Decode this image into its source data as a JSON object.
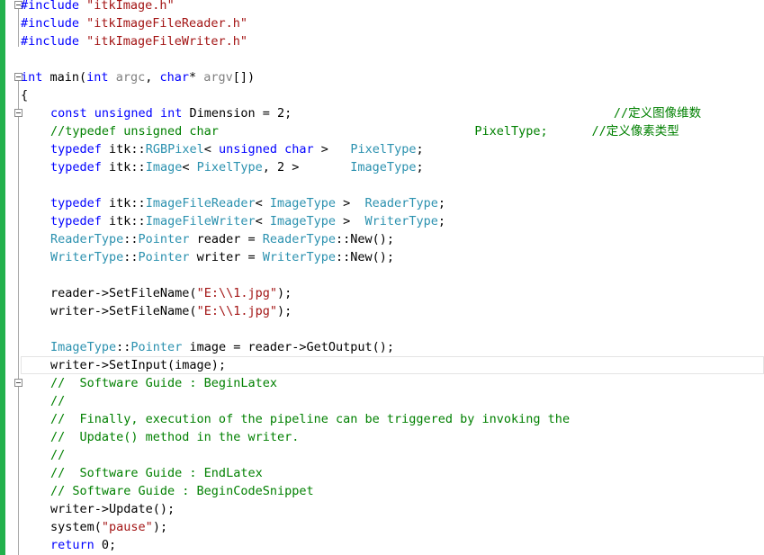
{
  "editor": {
    "lines": [
      {
        "indent": 0,
        "tokens": [
          {
            "t": "#include",
            "c": "pp"
          },
          {
            "t": " \"itkImage.h\"",
            "c": "str"
          }
        ]
      },
      {
        "indent": 0,
        "tokens": [
          {
            "t": "#include",
            "c": "pp"
          },
          {
            "t": " \"itkImageFileReader.h\"",
            "c": "str"
          }
        ]
      },
      {
        "indent": 0,
        "tokens": [
          {
            "t": "#include",
            "c": "pp"
          },
          {
            "t": " \"itkImageFileWriter.h\"",
            "c": "str"
          }
        ]
      },
      {
        "indent": 0,
        "tokens": []
      },
      {
        "indent": 0,
        "tokens": [
          {
            "t": "int",
            "c": "kw"
          },
          {
            "t": " main(",
            "c": "plain"
          },
          {
            "t": "int",
            "c": "kw"
          },
          {
            "t": " ",
            "c": "plain"
          },
          {
            "t": "argc",
            "c": "param"
          },
          {
            "t": ", ",
            "c": "plain"
          },
          {
            "t": "char",
            "c": "kw"
          },
          {
            "t": "* ",
            "c": "plain"
          },
          {
            "t": "argv",
            "c": "param"
          },
          {
            "t": "[])",
            "c": "plain"
          }
        ]
      },
      {
        "indent": 0,
        "tokens": [
          {
            "t": "{",
            "c": "plain"
          }
        ]
      },
      {
        "indent": 1,
        "tokens": [
          {
            "t": "const",
            "c": "kw"
          },
          {
            "t": " ",
            "c": "plain"
          },
          {
            "t": "unsigned",
            "c": "kw"
          },
          {
            "t": " ",
            "c": "plain"
          },
          {
            "t": "int",
            "c": "kw"
          },
          {
            "t": " Dimension = 2;                                            ",
            "c": "plain"
          },
          {
            "t": "//定义图像维数",
            "c": "cm"
          }
        ]
      },
      {
        "indent": 1,
        "tokens": [
          {
            "t": "//typedef unsigned char                                   ",
            "c": "cm"
          },
          {
            "t": "PixelType;      //定义像素类型",
            "c": "cm"
          }
        ]
      },
      {
        "indent": 1,
        "tokens": [
          {
            "t": "typedef",
            "c": "kw"
          },
          {
            "t": " itk::",
            "c": "plain"
          },
          {
            "t": "RGBPixel",
            "c": "type"
          },
          {
            "t": "< ",
            "c": "plain"
          },
          {
            "t": "unsigned",
            "c": "kw"
          },
          {
            "t": " ",
            "c": "plain"
          },
          {
            "t": "char",
            "c": "kw"
          },
          {
            "t": " >   ",
            "c": "plain"
          },
          {
            "t": "PixelType",
            "c": "type"
          },
          {
            "t": ";",
            "c": "plain"
          }
        ]
      },
      {
        "indent": 1,
        "tokens": [
          {
            "t": "typedef",
            "c": "kw"
          },
          {
            "t": " itk::",
            "c": "plain"
          },
          {
            "t": "Image",
            "c": "type"
          },
          {
            "t": "< ",
            "c": "plain"
          },
          {
            "t": "PixelType",
            "c": "type"
          },
          {
            "t": ", 2 >       ",
            "c": "plain"
          },
          {
            "t": "ImageType",
            "c": "type"
          },
          {
            "t": ";",
            "c": "plain"
          }
        ]
      },
      {
        "indent": 0,
        "tokens": []
      },
      {
        "indent": 1,
        "tokens": [
          {
            "t": "typedef",
            "c": "kw"
          },
          {
            "t": " itk::",
            "c": "plain"
          },
          {
            "t": "ImageFileReader",
            "c": "type"
          },
          {
            "t": "< ",
            "c": "plain"
          },
          {
            "t": "ImageType",
            "c": "type"
          },
          {
            "t": " >  ",
            "c": "plain"
          },
          {
            "t": "ReaderType",
            "c": "type"
          },
          {
            "t": ";",
            "c": "plain"
          }
        ]
      },
      {
        "indent": 1,
        "tokens": [
          {
            "t": "typedef",
            "c": "kw"
          },
          {
            "t": " itk::",
            "c": "plain"
          },
          {
            "t": "ImageFileWriter",
            "c": "type"
          },
          {
            "t": "< ",
            "c": "plain"
          },
          {
            "t": "ImageType",
            "c": "type"
          },
          {
            "t": " >  ",
            "c": "plain"
          },
          {
            "t": "WriterType",
            "c": "type"
          },
          {
            "t": ";",
            "c": "plain"
          }
        ]
      },
      {
        "indent": 1,
        "tokens": [
          {
            "t": "ReaderType",
            "c": "type"
          },
          {
            "t": "::",
            "c": "plain"
          },
          {
            "t": "Pointer",
            "c": "type"
          },
          {
            "t": " reader = ",
            "c": "plain"
          },
          {
            "t": "ReaderType",
            "c": "type"
          },
          {
            "t": "::New();",
            "c": "plain"
          }
        ]
      },
      {
        "indent": 1,
        "tokens": [
          {
            "t": "WriterType",
            "c": "type"
          },
          {
            "t": "::",
            "c": "plain"
          },
          {
            "t": "Pointer",
            "c": "type"
          },
          {
            "t": " writer = ",
            "c": "plain"
          },
          {
            "t": "WriterType",
            "c": "type"
          },
          {
            "t": "::New();",
            "c": "plain"
          }
        ]
      },
      {
        "indent": 0,
        "tokens": []
      },
      {
        "indent": 1,
        "tokens": [
          {
            "t": "reader->SetFileName(",
            "c": "plain"
          },
          {
            "t": "\"E:\\\\1.jpg\"",
            "c": "str"
          },
          {
            "t": ");",
            "c": "plain"
          }
        ]
      },
      {
        "indent": 1,
        "tokens": [
          {
            "t": "writer->SetFileName(",
            "c": "plain"
          },
          {
            "t": "\"E:\\\\1.jpg\"",
            "c": "str"
          },
          {
            "t": ");",
            "c": "plain"
          }
        ]
      },
      {
        "indent": 0,
        "tokens": []
      },
      {
        "indent": 1,
        "tokens": [
          {
            "t": "ImageType",
            "c": "type"
          },
          {
            "t": "::",
            "c": "plain"
          },
          {
            "t": "Pointer",
            "c": "type"
          },
          {
            "t": " image = reader->GetOutput();",
            "c": "plain"
          }
        ]
      },
      {
        "indent": 1,
        "tokens": [
          {
            "t": "writer->SetInput(image);",
            "c": "plain"
          }
        ]
      },
      {
        "indent": 1,
        "tokens": [
          {
            "t": "//  Software Guide : BeginLatex",
            "c": "cm"
          }
        ]
      },
      {
        "indent": 1,
        "tokens": [
          {
            "t": "//",
            "c": "cm"
          }
        ]
      },
      {
        "indent": 1,
        "tokens": [
          {
            "t": "//  Finally, execution of the pipeline can be triggered by invoking the",
            "c": "cm"
          }
        ]
      },
      {
        "indent": 1,
        "tokens": [
          {
            "t": "//  Update() method in the writer.",
            "c": "cm"
          }
        ]
      },
      {
        "indent": 1,
        "tokens": [
          {
            "t": "//",
            "c": "cm"
          }
        ]
      },
      {
        "indent": 1,
        "tokens": [
          {
            "t": "//  Software Guide : EndLatex",
            "c": "cm"
          }
        ]
      },
      {
        "indent": 1,
        "tokens": [
          {
            "t": "// Software Guide : BeginCodeSnippet",
            "c": "cm"
          }
        ]
      },
      {
        "indent": 1,
        "tokens": [
          {
            "t": "writer->Update();",
            "c": "plain"
          }
        ]
      },
      {
        "indent": 1,
        "tokens": [
          {
            "t": "system(",
            "c": "plain"
          },
          {
            "t": "\"pause\"",
            "c": "str"
          },
          {
            "t": ");",
            "c": "plain"
          }
        ]
      },
      {
        "indent": 1,
        "tokens": [
          {
            "t": "return",
            "c": "kw"
          },
          {
            "t": " 0;",
            "c": "plain"
          }
        ]
      }
    ]
  },
  "colors": {
    "change_bar": "#22b14c",
    "keyword": "#0000ff",
    "type": "#2b91af",
    "string": "#a31515",
    "comment": "#008000"
  }
}
